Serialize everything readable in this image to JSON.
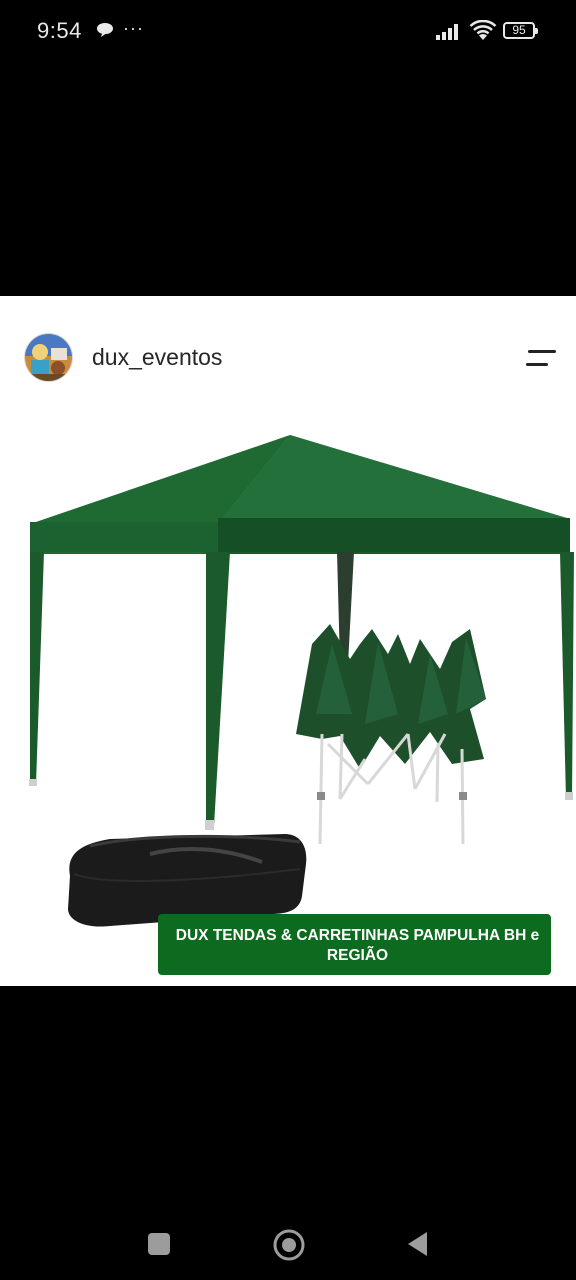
{
  "status_bar": {
    "time": "9:54",
    "dots": "···",
    "battery": "95",
    "icons": [
      "chat-icon",
      "signal-icon",
      "wifi-icon",
      "battery-icon"
    ]
  },
  "post": {
    "username": "dux_eventos",
    "image_caption": "DUX TENDAS & CARRETINHAS PAMPULHA BH e REGIÃO",
    "icons": [
      "avatar",
      "menu-icon"
    ]
  },
  "navigation": {
    "buttons": [
      "recents-button",
      "home-button",
      "back-button"
    ]
  },
  "colors": {
    "background": "#000000",
    "post_background": "#ffffff",
    "tent_green": "#1d5a2c",
    "banner_green": "#0c6b1f",
    "status_text": "#e9e9e9"
  }
}
